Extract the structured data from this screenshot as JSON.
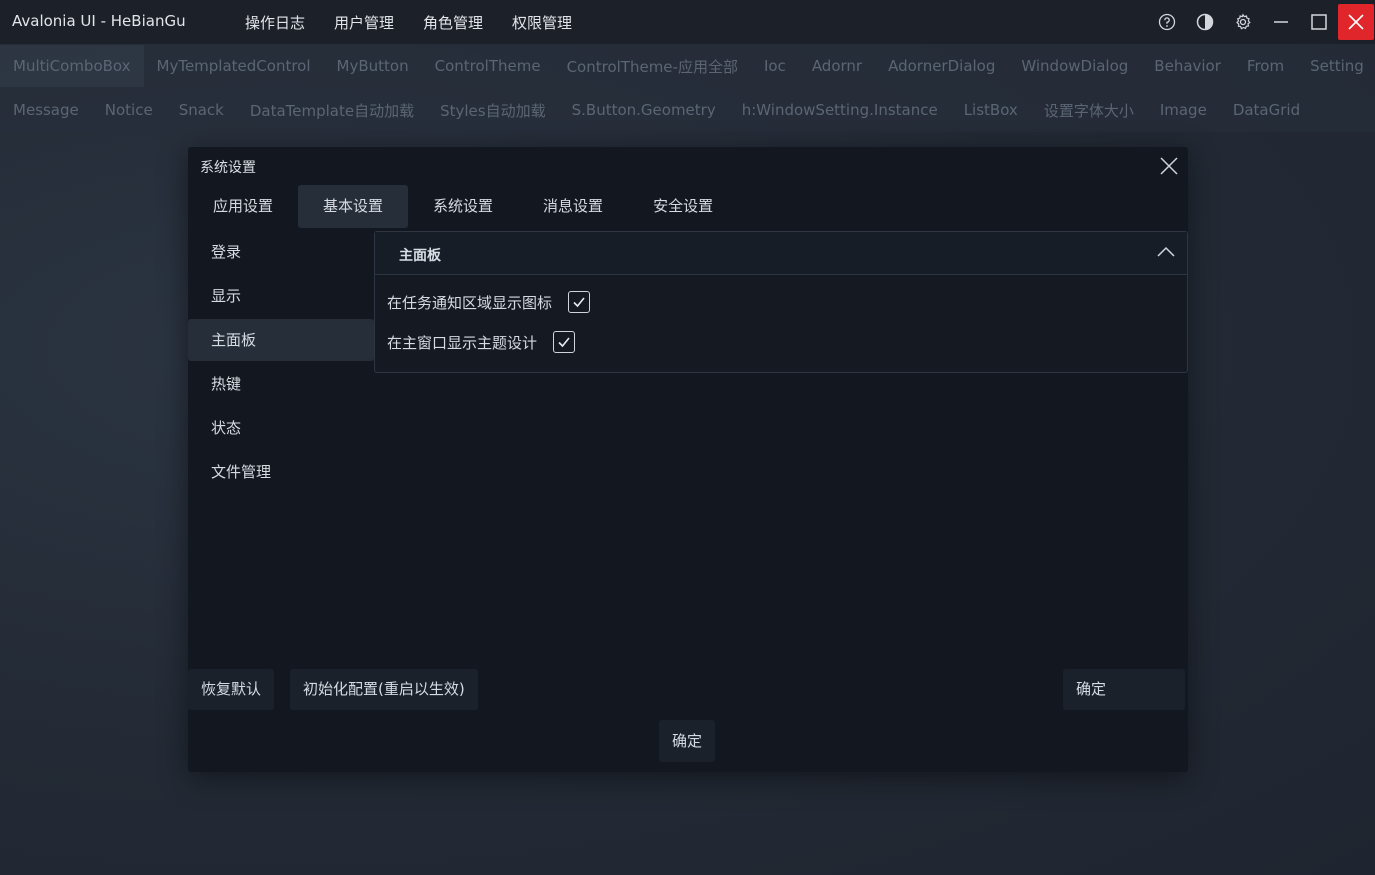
{
  "app": {
    "title": "Avalonia UI - HeBianGu",
    "top_menu": [
      "操作日志",
      "用户管理",
      "角色管理",
      "权限管理"
    ],
    "window_controls": [
      "help-icon",
      "theme-contrast-icon",
      "gear-icon",
      "minimize-icon",
      "maximize-icon",
      "close-icon"
    ],
    "close_color": "#e0262b"
  },
  "nav_row_1": [
    "MultiComboBox",
    "MyTemplatedControl",
    "MyButton",
    "ControlTheme",
    "ControlTheme-应用全部",
    "Ioc",
    "Adornr",
    "AdornerDialog",
    "WindowDialog",
    "Behavior",
    "From",
    "Setting"
  ],
  "nav_row_2": [
    "Message",
    "Notice",
    "Snack",
    "DataTemplate自动加载",
    "Styles自动加载",
    "S.Button.Geometry",
    "h:WindowSetting.Instance",
    "ListBox",
    "设置字体大小",
    "Image",
    "DataGrid"
  ],
  "dialog": {
    "title": "系统设置",
    "tabs": [
      "应用设置",
      "基本设置",
      "系统设置",
      "消息设置",
      "安全设置"
    ],
    "active_tab": "基本设置",
    "sidebar": [
      "登录",
      "显示",
      "主面板",
      "热键",
      "状态",
      "文件管理"
    ],
    "active_sidebar": "主面板",
    "panel": {
      "title": "主面板",
      "options": [
        {
          "label": "在任务通知区域显示图标",
          "checked": true
        },
        {
          "label": "在主窗口显示主题设计",
          "checked": true
        }
      ]
    },
    "buttons": {
      "restore": "恢复默认",
      "init": "初始化配置(重启以生效)",
      "confirm_right": "确定",
      "confirm_bottom": "确定"
    }
  }
}
